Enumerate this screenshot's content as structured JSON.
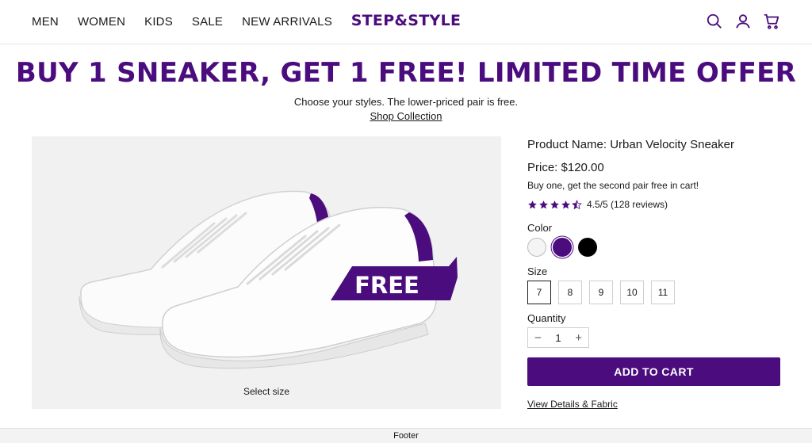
{
  "nav": {
    "links": [
      "MEN",
      "WOMEN",
      "KIDS",
      "SALE",
      "NEW ARRIVALS"
    ],
    "logo": "STEP&STYLE"
  },
  "icons": [
    "search-icon",
    "account-icon",
    "cart-icon"
  ],
  "promo": {
    "title": "BUY 1 SNEAKER, GET 1 FREE! LIMITED TIME OFFER",
    "subtitle": "Choose your styles. The lower-priced pair is free.",
    "link": "Shop Collection"
  },
  "image": {
    "badge": "FREE",
    "caption": "Select size"
  },
  "product": {
    "name": "Product Name: Urban Velocity Sneaker",
    "price": "Price: $120.00",
    "offer": "Buy one, get the second pair free in cart!",
    "rating_value": 4.5,
    "rating_text": "4.5/5 (128 reviews)",
    "color_label": "Color",
    "colors": [
      "#f4f4f4",
      "#4b0c7e",
      "#000000"
    ],
    "size_label": "Size",
    "sizes": [
      "7",
      "8",
      "9",
      "10",
      "11"
    ],
    "selected_size": "7",
    "quantity_label": "Quantity",
    "quantity": "1",
    "add_to_cart": "ADD TO CART",
    "details_link": "View Details & Fabric"
  },
  "footer": "Footer",
  "theme": {
    "accent": "#4b0c7e"
  }
}
